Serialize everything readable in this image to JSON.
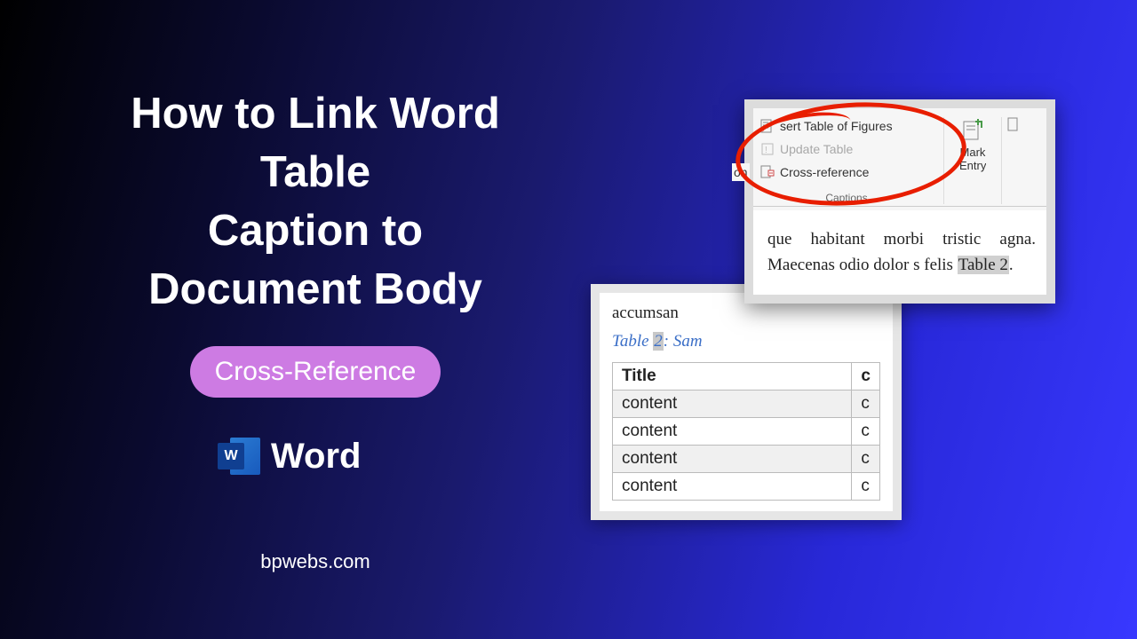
{
  "title": {
    "line1": "How to Link Word Table",
    "line2": "Caption to",
    "line3": "Document Body"
  },
  "badge_label": "Cross-Reference",
  "word_brand": "Word",
  "word_letter": "W",
  "footer": "bpwebs.com",
  "back_screenshot": {
    "body_fragment": "accumsan",
    "caption_prefix": "Table ",
    "caption_marked": "2",
    "caption_suffix": ": Sam",
    "table": {
      "header": "Title",
      "col2_frag": "c",
      "rows": [
        "content",
        "content",
        "content",
        "content"
      ]
    }
  },
  "front_screenshot": {
    "on_fragment": "on",
    "ribbon": {
      "insert_tof_frag": "sert Table of Figures",
      "update": "Update Table",
      "xref": "Cross-reference",
      "captions_label": "Captions",
      "mark_l1": "Mark",
      "mark_l2_frag": "Entry"
    },
    "doc": {
      "line1_frag": "que habitant morbi tristic",
      "line2_frag": "agna. Maecenas odio dolor",
      "line3_pre": "s felis ",
      "line3_mark": "Table 2",
      "line3_post": "."
    }
  }
}
